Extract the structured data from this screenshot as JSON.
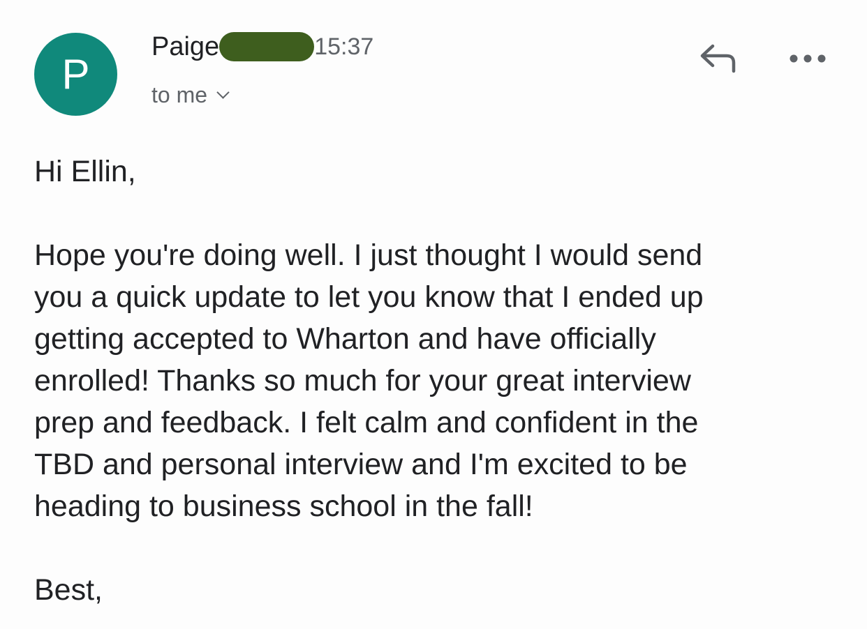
{
  "avatar": {
    "initial": "P",
    "color": "#10897b"
  },
  "header": {
    "sender_name": "Paige",
    "time": "15:37",
    "recipient": "to me",
    "redaction_color": "#3e5e1e"
  },
  "icons": {
    "reply": "reply-arrow-icon",
    "more": "three-dots-icon",
    "expand": "chevron-down-icon"
  },
  "message": {
    "greeting": "Hi Ellin,",
    "lines": [
      "Hope you're doing well. I just thought I would send",
      "you a quick update to let you know that I ended up",
      "getting accepted to Wharton and have officially",
      "enrolled! Thanks so much for your great interview",
      "prep and feedback. I felt calm and confident in the",
      "TBD and personal interview and I'm excited to be",
      "heading to business school in the fall!"
    ],
    "signoff": "Best,"
  }
}
